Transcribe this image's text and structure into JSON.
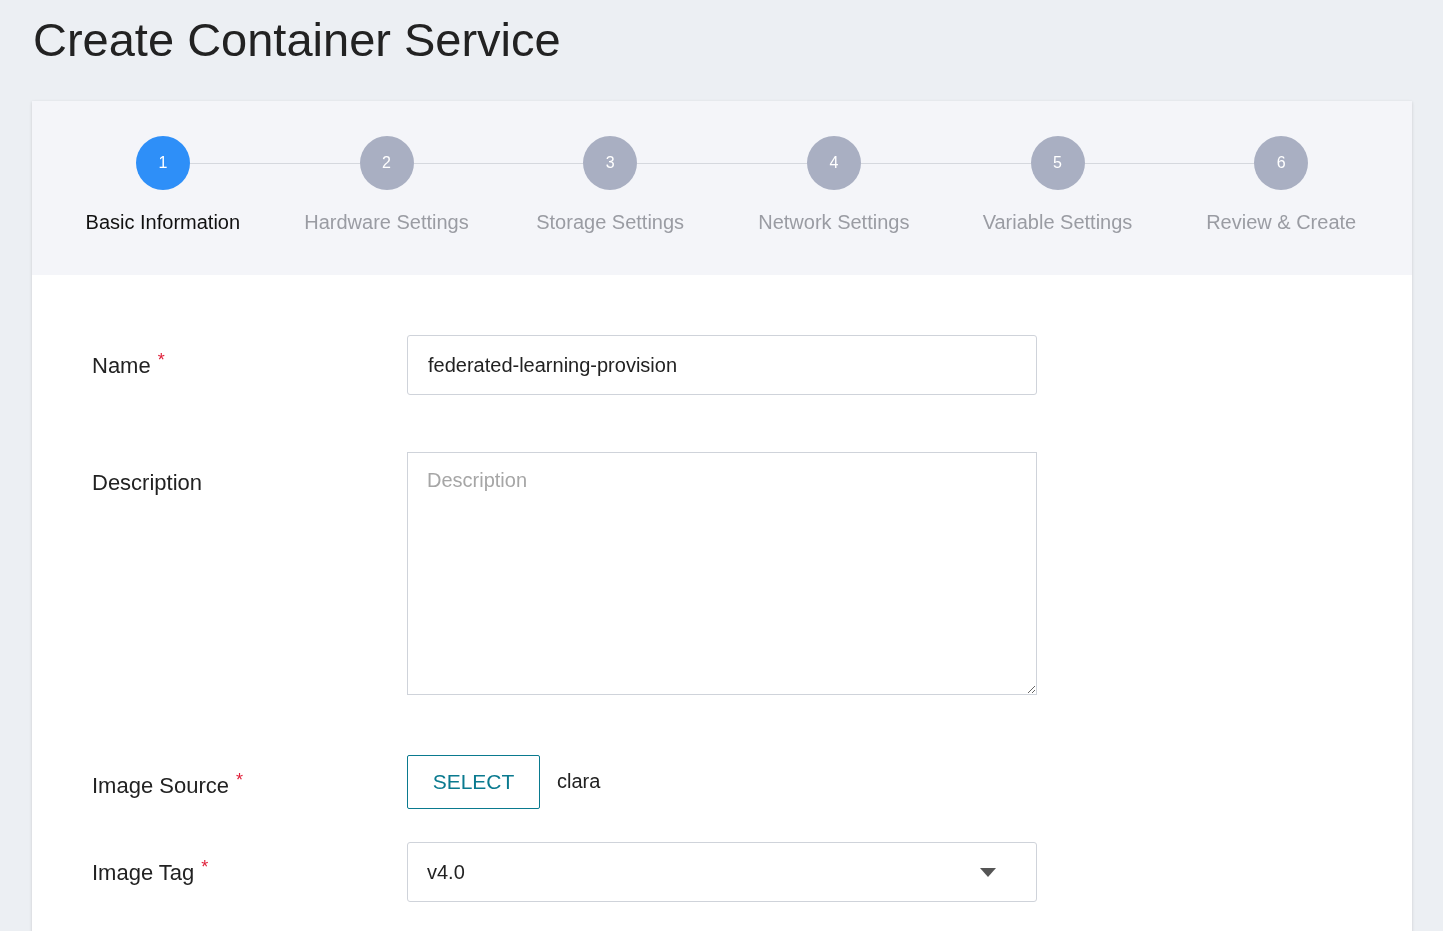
{
  "page_title": "Create Container Service",
  "steps": [
    {
      "number": "1",
      "label": "Basic Information",
      "selected": true
    },
    {
      "number": "2",
      "label": "Hardware Settings",
      "selected": false
    },
    {
      "number": "3",
      "label": "Storage Settings",
      "selected": false
    },
    {
      "number": "4",
      "label": "Network Settings",
      "selected": false
    },
    {
      "number": "5",
      "label": "Variable Settings",
      "selected": false
    },
    {
      "number": "6",
      "label": "Review & Create",
      "selected": false
    }
  ],
  "form": [
    {
      "kind": "text",
      "label": "Name",
      "required_mark": "*",
      "value": "federated-learning-provision"
    },
    {
      "kind": "textarea",
      "label": "Description",
      "placeholder": "Description"
    },
    {
      "kind": "select_button",
      "label": "Image Source",
      "required_mark": "*",
      "button": "SELECT",
      "value": "clara"
    },
    {
      "kind": "dropdown",
      "label": "Image Tag",
      "required_mark": "*",
      "value": "v4.0"
    }
  ]
}
